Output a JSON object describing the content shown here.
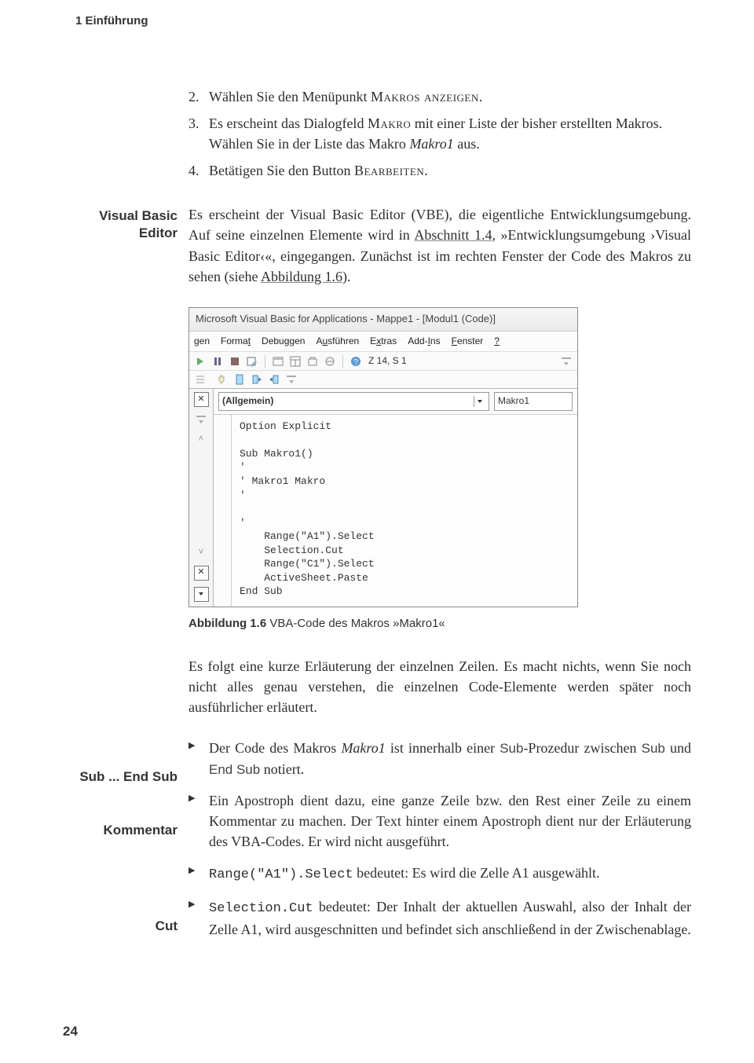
{
  "running_head": "1   Einführung",
  "steps": [
    {
      "num": "2.",
      "html": "Wählen Sie den Menüpunkt <span class='smallcaps'>Makros anzeigen</span>."
    },
    {
      "num": "3.",
      "html": "Es erscheint das Dialogfeld <span class='smallcaps'>Makro</span> mit einer Liste der bisher erstellten Makros. Wählen Sie in der Liste das Makro <em class='title-italic'>Makro1</em> aus."
    },
    {
      "num": "4.",
      "html": "Betätigen Sie den Button <span class='smallcaps'>Bearbeiten</span>."
    }
  ],
  "margin_notes": {
    "note1": "Visual Basic Editor",
    "note2": "Sub ... End Sub",
    "note3": "Kommentar",
    "note4": "Cut"
  },
  "para1_html": "Es erscheint der Visual Basic Editor (VBE), die eigentliche Entwicklungsumgebung. Auf seine einzelnen Elemente wird in <span class='link-like'>Abschnitt 1.4</span>, »Entwicklungsumgebung ›Visual Basic Editor‹«, eingegangen. Zunächst ist im rechten Fenster der Code des Makros zu sehen (siehe <span class='link-like'>Abbildung 1.6</span>).",
  "vbe": {
    "title": "Microsoft Visual Basic for Applications - Mappe1 - [Modul1 (Code)]",
    "menus": [
      "gen",
      "Format",
      "Debuggen",
      "Ausführen",
      "Extras",
      "Add-Ins",
      "Fenster",
      "?"
    ],
    "menu_underlines": [
      "",
      "t",
      "",
      "u",
      "x",
      "I",
      "F",
      "?"
    ],
    "pos": "Z 14, S 1",
    "combo_left": "(Allgemein)",
    "combo_right": "Makro1",
    "code": "Option Explicit\n\nSub Makro1()\n'\n' Makro1 Makro\n'\n\n'\n    Range(\"A1\").Select\n    Selection.Cut\n    Range(\"C1\").Select\n    ActiveSheet.Paste\nEnd Sub"
  },
  "caption_bold": "Abbildung 1.6",
  "caption_rest": "  VBA-Code des Makros »Makro1«",
  "para2": "Es folgt eine kurze Erläuterung der einzelnen Zeilen. Es macht nichts, wenn Sie noch nicht alles genau verstehen, die einzelnen Code-Elemente werden später noch ausführlicher erläutert.",
  "bullets": [
    "Der Code des Makros <em class='title-italic'>Makro1</em> ist innerhalb einer <span class='code-inline'>Sub</span>-Prozedur zwischen <span class='code-inline'>Sub</span> und <span class='code-inline'>End Sub</span> notiert.",
    "Ein Apostroph dient dazu, eine ganze Zeile bzw. den Rest einer Zeile zu einem Kommentar zu machen. Der Text hinter einem Apostroph dient nur der Erläuterung des VBA-Codes. Er wird nicht ausgeführt.",
    "<span class='mono-inline'>Range(\"A1\").Select</span> bedeutet: Es wird die Zelle A1 ausgewählt.",
    "<span class='mono-inline'>Selection.Cut</span> bedeutet: Der Inhalt der aktuellen Auswahl, also der Inhalt der Zelle A1, wird ausgeschnitten und befindet sich anschließend in der Zwischenablage."
  ],
  "page_number": "24"
}
